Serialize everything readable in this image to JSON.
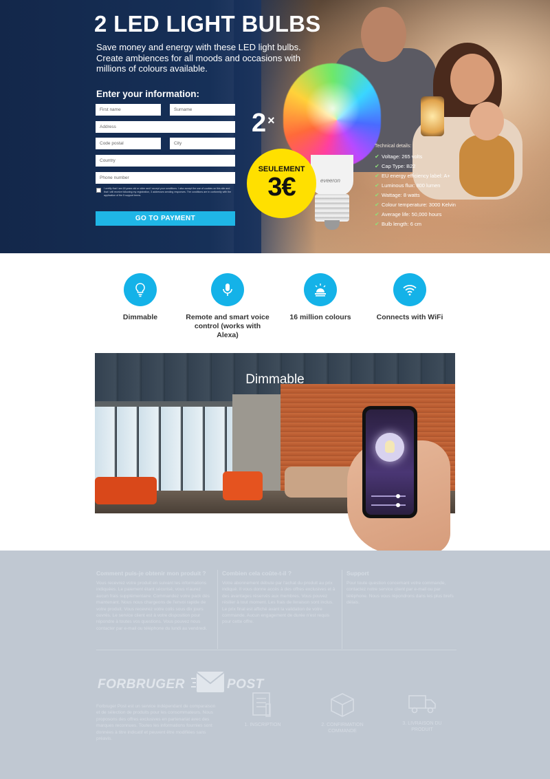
{
  "hero": {
    "title": "2 LED LIGHT BULBS",
    "subtitle": "Save money and energy with these LED light bulbs. Create ambiences for all moods and occasions with millions of colours available.",
    "multiplier": "2",
    "multiplier_sign": "×",
    "bulb_brand": "eveeron"
  },
  "form": {
    "title": "Enter your information:",
    "fields": {
      "first_name": "First name",
      "surname": "Surname",
      "address": "Address",
      "postal_code": "Code postal",
      "city": "City",
      "country": "Country",
      "phone": "Phone number"
    },
    "consent_text": "I certify that I am 18 years old or older and I accept your conditions. I also accept the use of cookies on this site and that I will receive following my registration, 3 addresses sending responses. The conditions are in conformity with the application of the 5 support terms.",
    "submit_label": "GO TO PAYMENT"
  },
  "price_badge": {
    "label": "SEULEMENT",
    "price": "3€"
  },
  "specs": {
    "header": "Technical details:",
    "items": [
      "Voltage: 265 volts",
      "Cap Type: B22",
      "EU energy efficiency label: A+",
      "Luminous flux: 800 lumen",
      "Wattage: 8 watts",
      "Colour temperature: 3000 Kelvin",
      "Average life: 50,000 hours",
      "Bulb length: 6 cm"
    ]
  },
  "features": [
    {
      "label": "Dimmable",
      "icon": "lightbulb-icon"
    },
    {
      "label": "Remote and smart voice control (works with Alexa)",
      "icon": "microphone-icon"
    },
    {
      "label": "16 million colours",
      "icon": "lamp-icon"
    },
    {
      "label": "Connects with WiFi",
      "icon": "wifi-icon"
    }
  ],
  "scene": {
    "title": "Dimmable"
  },
  "footer": {
    "columns": [
      {
        "heading": "Comment puis-je obtenir mon produit ?",
        "text": "Vous recevrez votre produit en suivant les informations indiquées. Le paiement étant sécurisé, vous n'aurez aucun frais supplémentaire. Commandez votre pack dès maintenant. Nous nous chargeons de l'envoi rapide de votre produit. Vous recevrez votre colis sous dix jours ouvrés. Le service client est à votre disposition pour répondre à toutes vos questions. Vous pouvez nous contacter par e-mail ou téléphone du lundi au vendredi."
      },
      {
        "heading": "Combien cela coûte-t-il ?",
        "text": "Votre abonnement débute par l'achat du produit au prix indiqué. Il vous donne accès à des offres exclusives et à des avantages réservés aux membres. Vous pouvez résilier à tout moment. Les frais de livraison sont inclus. Le prix final est affiché avant la validation de votre commande. Aucun engagement de durée n'est requis pour cette offre."
      },
      {
        "heading": "Support",
        "text": "Pour toute question concernant votre commande, contactez notre service client par e-mail ou par téléphone. Nous vous répondrons dans les plus brefs délais."
      }
    ],
    "brand_left": "FORBRUGER",
    "brand_right": "POST",
    "bottom_text": "Forbruger Post est un service indépendant de comparaison et de sélection de produits pour les consommateurs. Nous proposons des offres exclusives en partenariat avec des marques reconnues. Toutes les informations fournies sont données à titre indicatif et peuvent être modifiées sans préavis.",
    "steps": [
      {
        "label": "1. INSCRIPTION",
        "icon": "form-icon"
      },
      {
        "label": "2. CONFIRMATION COMMANDE",
        "icon": "box-icon"
      },
      {
        "label": "3. LIVRAISON DU PRODUIT",
        "icon": "truck-icon"
      }
    ]
  },
  "colors": {
    "hero_bg": "#13274a",
    "accent_blue": "#14b2e8",
    "price_yellow": "#ffe000",
    "footer_bg": "#c0c8d2"
  }
}
